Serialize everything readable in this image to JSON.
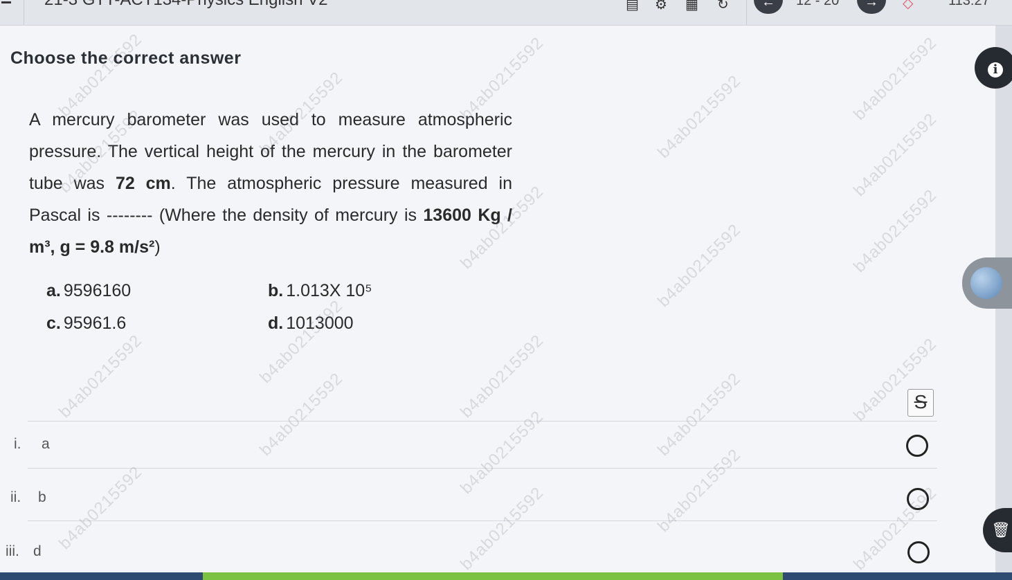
{
  "topbar": {
    "title": "21-3 GTT-ACT134-Physics English V2",
    "pager": "12 - 20",
    "timer": "113:27"
  },
  "heading": "Choose the correct answer",
  "question": {
    "p1": "A mercury barometer was used to measure atmospheric pressure. The vertical height of the mercury in the barometer tube was ",
    "height": "72 cm",
    "p2": ". The atmospheric pressure measured in Pascal is -------- (Where the density of mercury is ",
    "density": "13600 Kg / m³, g = 9.8 m/s²",
    "p3": ")"
  },
  "options": [
    {
      "label": "a.",
      "text": "9596160"
    },
    {
      "label": "b.",
      "text": "1.013X 10⁵"
    },
    {
      "label": "c.",
      "text": "95961.6"
    },
    {
      "label": "d.",
      "text": "1013000"
    }
  ],
  "answers": [
    {
      "roman": "i.",
      "letter": "a"
    },
    {
      "roman": "ii.",
      "letter": "b"
    },
    {
      "roman": "iii.",
      "letter": "d"
    }
  ],
  "strike_symbol": "S",
  "watermark": "b4ab0215592",
  "progress": 0.57,
  "colors": {
    "progress_fill": "#7cc242",
    "progress_track": "#2f4b72",
    "dark_button": "#262a31"
  }
}
